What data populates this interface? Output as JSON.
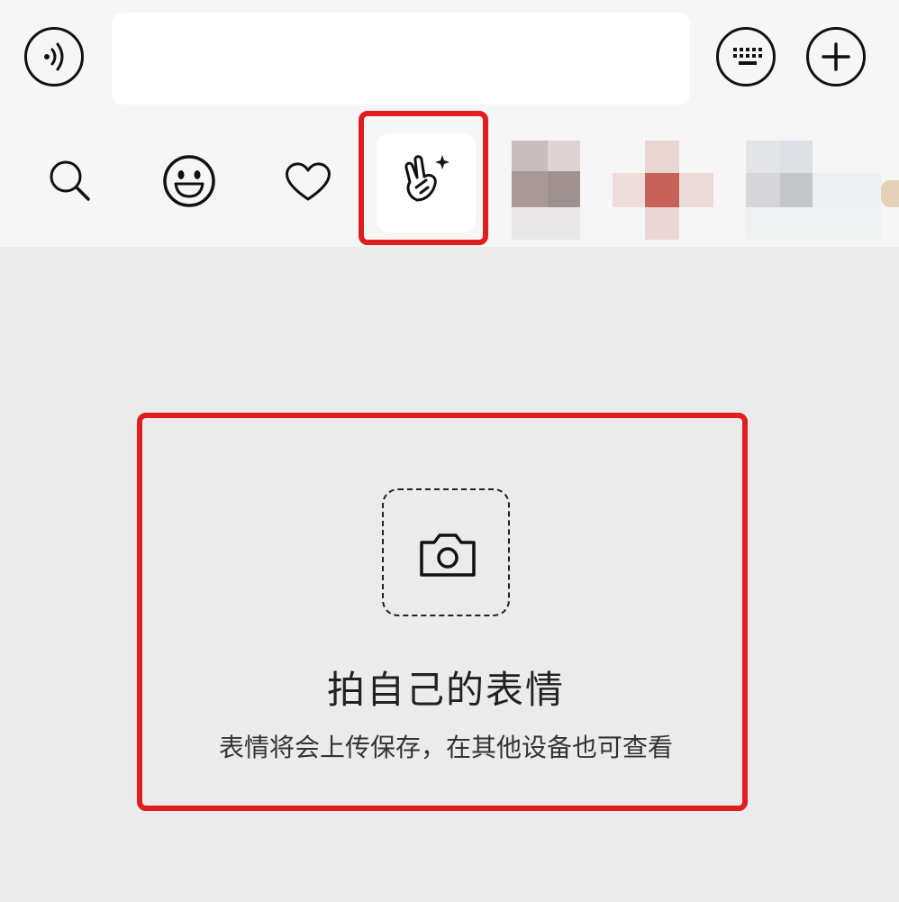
{
  "input_bar": {
    "voice_icon": "voice-icon",
    "keyboard_icon": "keyboard-icon",
    "plus_icon": "plus-icon",
    "text_value": ""
  },
  "tabs": [
    {
      "name": "search",
      "icon": "search-icon"
    },
    {
      "name": "emoji",
      "icon": "smiley-icon"
    },
    {
      "name": "favorites",
      "icon": "heart-icon"
    },
    {
      "name": "selfie-sticker",
      "icon": "victory-hand-sparkle-icon",
      "selected": true
    }
  ],
  "selfie_panel": {
    "title": "拍自己的表情",
    "subtitle": "表情将会上传保存，在其他设备也可查看",
    "camera_icon": "camera-icon"
  },
  "colors": {
    "highlight": "#e11d1d",
    "background": "#ebebeb",
    "bar": "#f6f6f6"
  }
}
